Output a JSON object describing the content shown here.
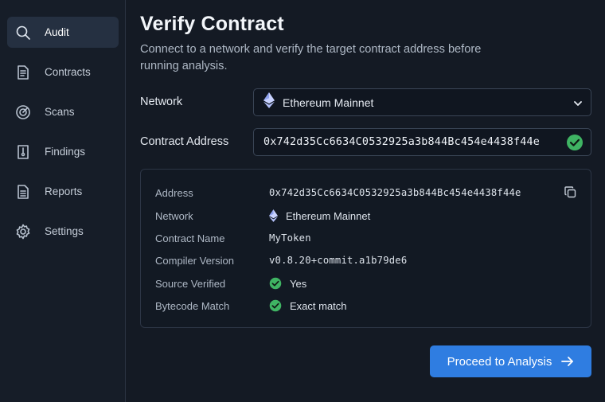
{
  "sidebar": {
    "items": [
      {
        "label": "Audit",
        "icon": "search-icon",
        "active": true
      },
      {
        "label": "Contracts",
        "icon": "document-icon"
      },
      {
        "label": "Scans",
        "icon": "radar-icon"
      },
      {
        "label": "Findings",
        "icon": "findings-icon"
      },
      {
        "label": "Reports",
        "icon": "report-icon"
      },
      {
        "label": "Settings",
        "icon": "gear-icon"
      }
    ]
  },
  "main": {
    "title": "Verify Contract",
    "subtitle": "Connect to a network and verify the target contract address before running analysis.",
    "network_label": "Network",
    "network_value": "Ethereum Mainnet",
    "address_label": "Contract Address",
    "address_value": "0x742d35Cc6634C0532925a3b844Bc454e4438f44e"
  },
  "details": {
    "rows": [
      {
        "key": "Address",
        "value": "0x742d35Cc6634C0532925a3b844Bc454e4438f44e"
      },
      {
        "key": "Network",
        "value": "Ethereum Mainnet"
      },
      {
        "key": "Contract Name",
        "value": "MyToken"
      },
      {
        "key": "Compiler Version",
        "value": "v0.8.20+commit.a1b79de6"
      },
      {
        "key": "Source Verified",
        "value": "Yes"
      },
      {
        "key": "Bytecode Match",
        "value": "Exact match"
      }
    ]
  },
  "actions": {
    "proceed_label": "Proceed to Analysis"
  },
  "colors": {
    "accent": "#2f7de1",
    "success": "#3fb463",
    "background": "#141a24"
  }
}
